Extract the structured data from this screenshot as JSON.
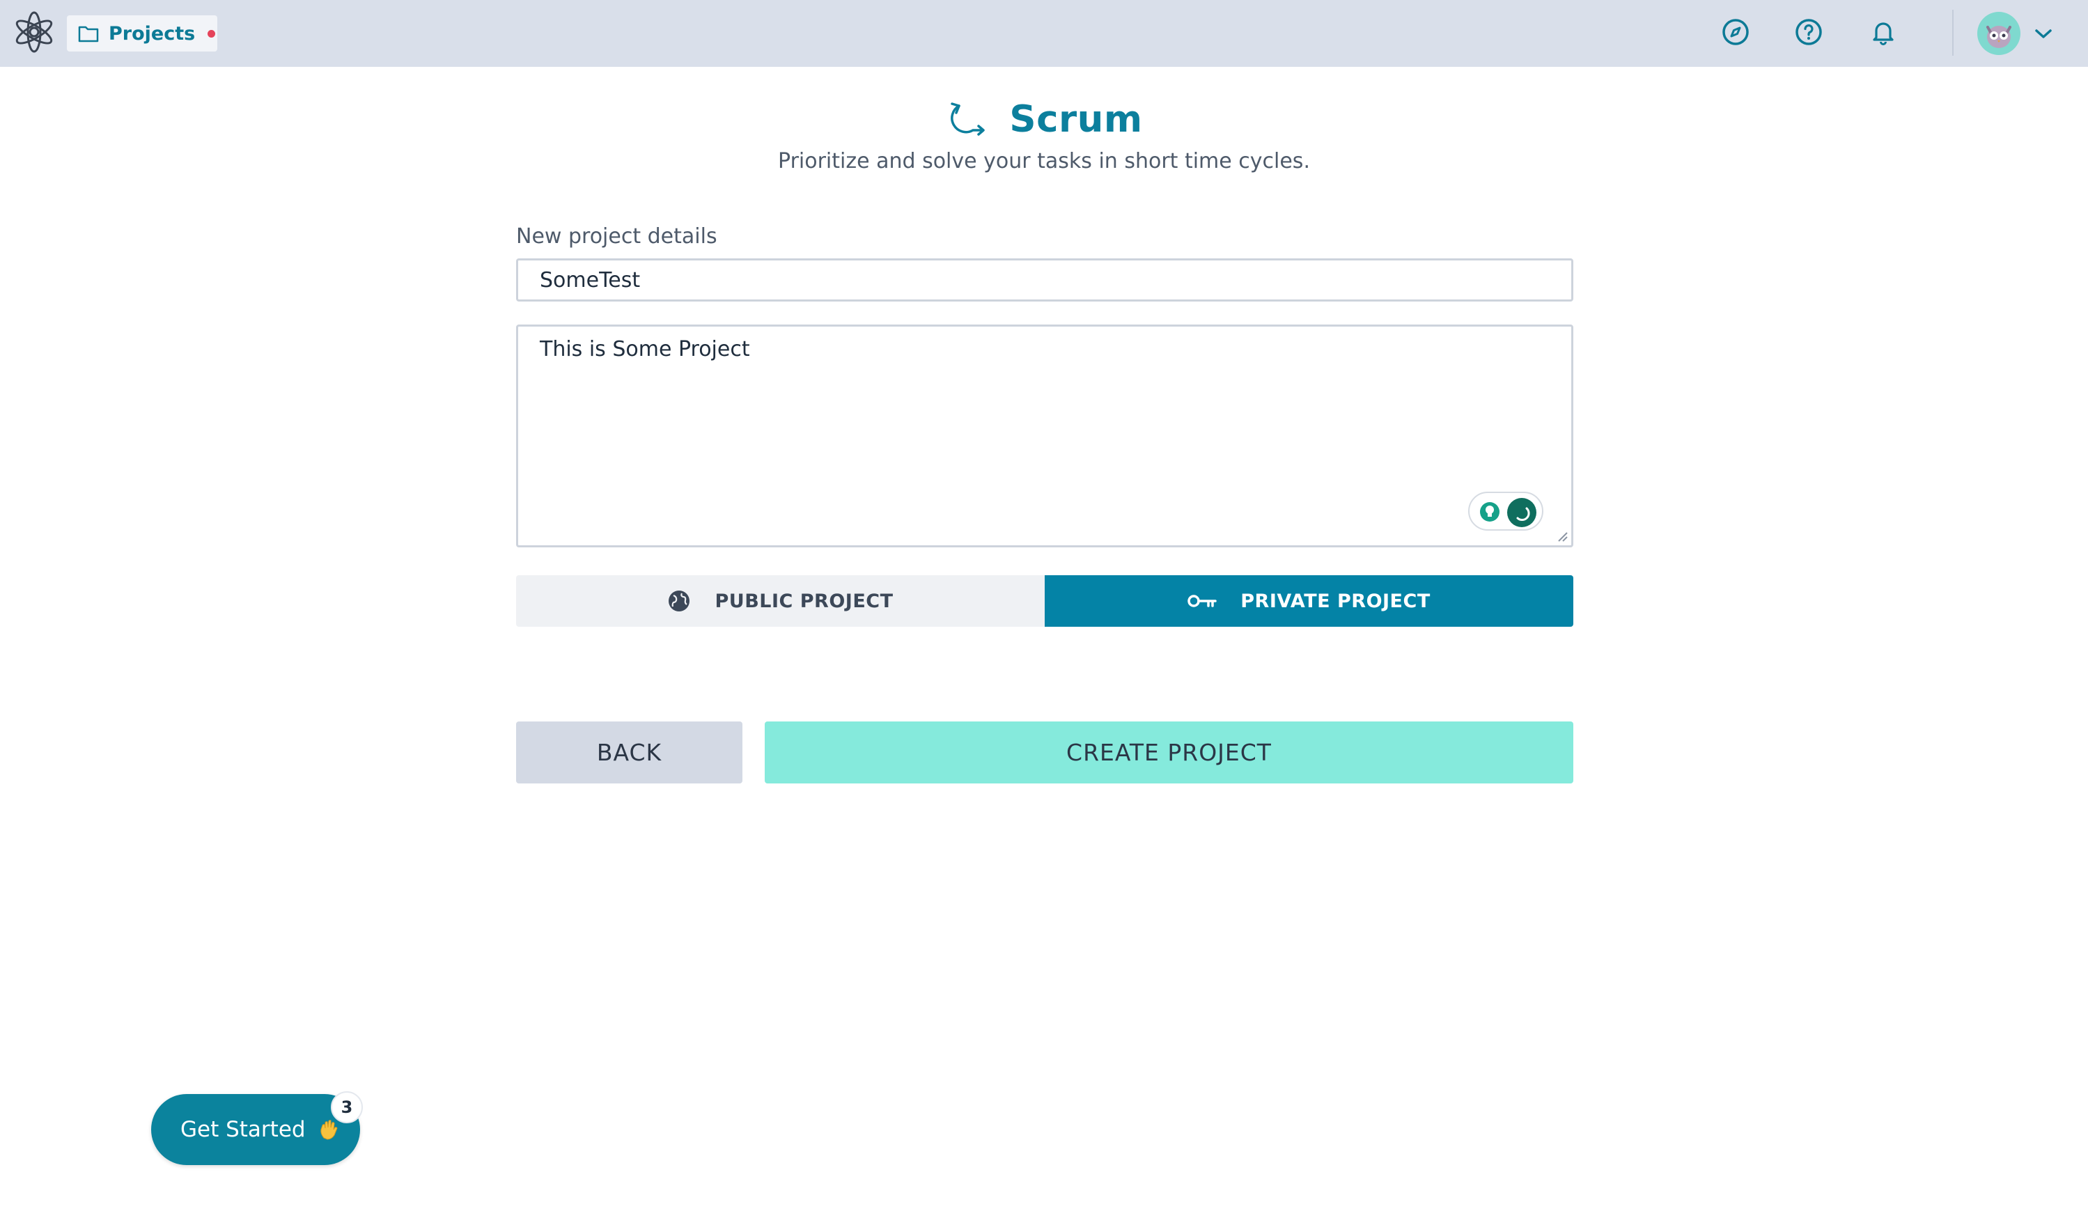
{
  "topbar": {
    "breadcrumb_label": "Projects",
    "icons": [
      "compass-icon",
      "help-icon",
      "bell-icon"
    ],
    "notification_dot_color": "#e5435a"
  },
  "header": {
    "title": "Scrum",
    "subtitle": "Prioritize and solve your tasks in short time cycles.",
    "accent_color": "#0c7f9d"
  },
  "form": {
    "section_label": "New project details",
    "name_value": "SomeTest",
    "description_value": "This is Some Project"
  },
  "visibility": {
    "options": [
      {
        "label": "PUBLIC PROJECT",
        "icon": "globe-icon",
        "selected": false
      },
      {
        "label": "PRIVATE PROJECT",
        "icon": "key-icon",
        "selected": true
      }
    ],
    "selected_color": "#0483a6"
  },
  "actions": {
    "back_label": "BACK",
    "create_label": "CREATE PROJECT",
    "create_color": "#85eadc"
  },
  "onboarding": {
    "label": "Get Started",
    "badge_count": "3",
    "icon": "waving-hand-icon"
  }
}
